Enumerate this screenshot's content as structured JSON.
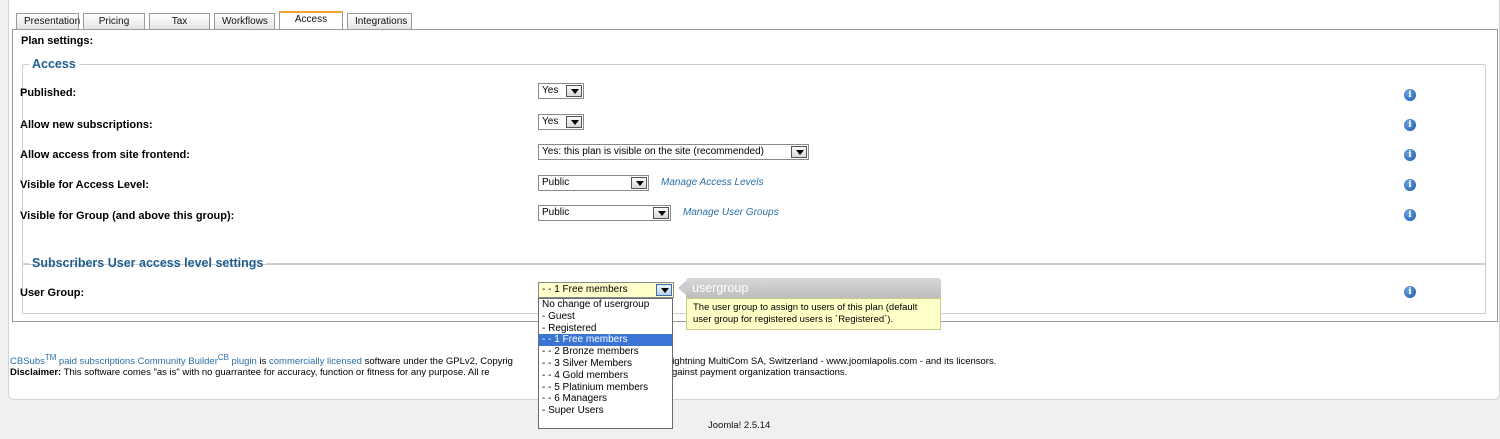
{
  "tabs": [
    "Presentation",
    "Pricing",
    "Tax",
    "Workflows",
    "Access",
    "Integrations"
  ],
  "plan_settings_label": "Plan settings:",
  "access_section": {
    "legend": "Access",
    "published": {
      "label": "Published:",
      "value": "Yes"
    },
    "allow_new": {
      "label": "Allow new subscriptions:",
      "value": "Yes"
    },
    "allow_frontend": {
      "label": "Allow access from site frontend:",
      "value": "Yes: this plan is visible on the site (recommended)"
    },
    "visible_access_level": {
      "label": "Visible for Access Level:",
      "value": "Public",
      "link": "Manage Access Levels"
    },
    "visible_group": {
      "label": "Visible for Group (and above this group):",
      "value": "Public",
      "link": "Manage User Groups"
    }
  },
  "subscribers_section": {
    "legend": "Subscribers User access level settings",
    "user_group": {
      "label": "User Group:",
      "value": "- - 1 Free members"
    }
  },
  "dropdown_options": [
    "No change of usergroup",
    "- Guest",
    "- Registered",
    "- - 1 Free members",
    "- - 2 Bronze members",
    "- - 3 Silver Members",
    "- - 4 Gold members",
    "- - 5 Platinium members",
    "- - 6 Managers",
    "- Super Users"
  ],
  "selected_option_index": 3,
  "tooltip": {
    "title": "usergroup",
    "body": "The user group to assign to users of this plan (default user group for registered users is `Registered`)."
  },
  "footer": {
    "line1_cbsubs": "CBSubs",
    "line1_tm": "TM",
    "line1_link1": "paid subscriptions Community Builder",
    "line1_cb": "CB",
    "line1_link2": "plugin",
    "line1_is": "is",
    "line1_licensed": "commercially licensed",
    "line1_rest": "software under the GPLv2, Copyrig",
    "line1_tail": "k of Lightning MultiCom SA, Switzerland - www.joomlapolis.com - and its licensors.",
    "line2_bold": "Disclaimer:",
    "line2_rest": "This software comes \"as is\" with no guarrantee for accuracy, function or fitness for any purpose. All re",
    "line2_tail": "-checked against payment organization transactions."
  },
  "version": "Joomla! 2.5.14",
  "colors": {
    "accent": "#1f5f8f",
    "link": "#2a6fa8",
    "active_tab": "#f4a42a",
    "selected": "#3a75d6",
    "tooltip_bg": "#ffffc8"
  },
  "icons": {
    "info": "info-icon",
    "dropdown": "chevron-down-icon"
  }
}
